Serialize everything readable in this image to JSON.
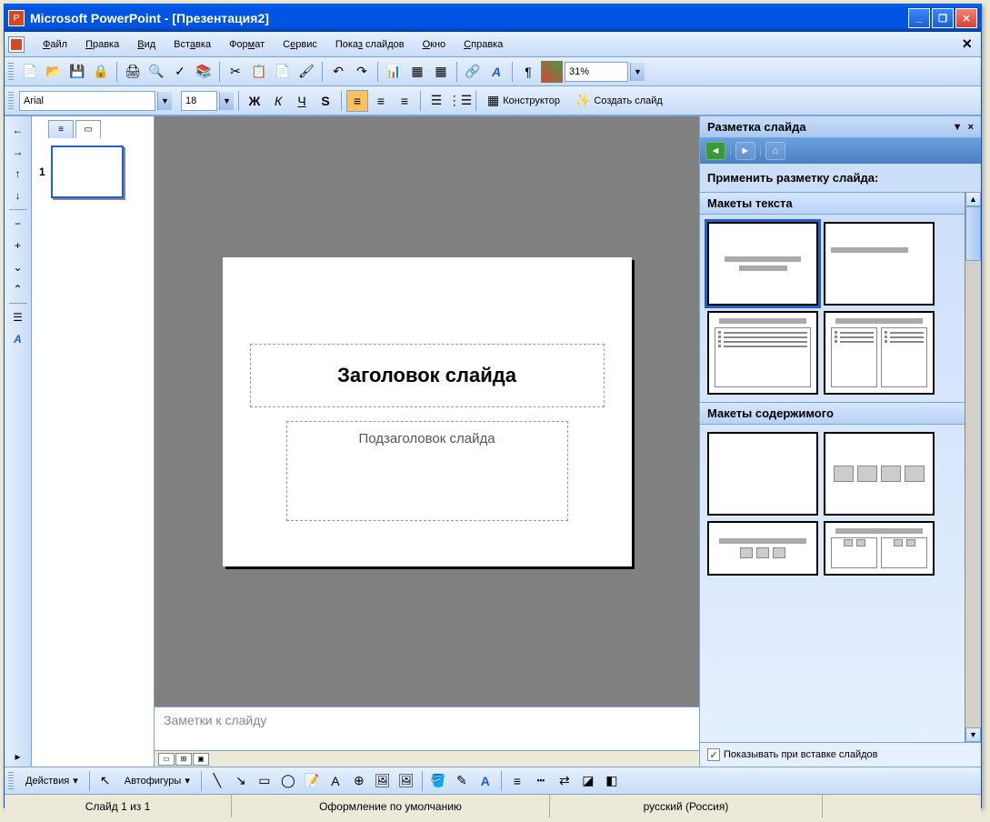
{
  "title": "Microsoft PowerPoint - [Презентация2]",
  "menu": [
    "Файл",
    "Правка",
    "Вид",
    "Вставка",
    "Формат",
    "Сервис",
    "Показ слайдов",
    "Окно",
    "Справка"
  ],
  "formatting": {
    "font_name": "Arial",
    "font_size": "18",
    "design_btn": "Конструктор",
    "new_slide_btn": "Создать слайд"
  },
  "zoom": "31%",
  "slide_panel": {
    "num": "1"
  },
  "slide": {
    "title_ph": "Заголовок слайда",
    "subtitle_ph": "Подзаголовок слайда"
  },
  "notes": "Заметки к слайду",
  "task_pane": {
    "title": "Разметка слайда",
    "apply_label": "Применить разметку слайда:",
    "section_text": "Макеты текста",
    "section_content": "Макеты содержимого",
    "checkbox_label": "Показывать при вставке слайдов"
  },
  "drawing": {
    "actions": "Действия",
    "autoshapes": "Автофигуры"
  },
  "status": {
    "slide": "Слайд 1 из 1",
    "design": "Оформление по умолчанию",
    "lang": "русский (Россия)"
  }
}
